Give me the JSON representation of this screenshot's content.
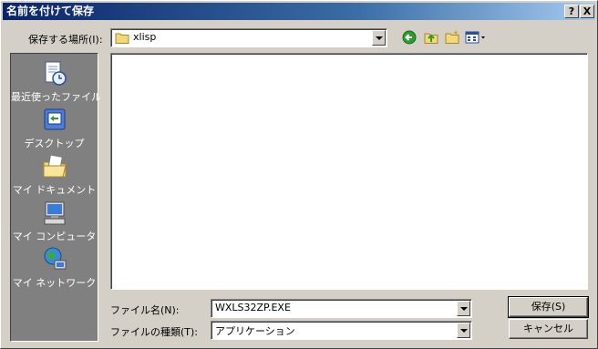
{
  "window": {
    "title": "名前を付けて保存",
    "help_glyph": "?",
    "close_glyph": "X"
  },
  "location": {
    "label": "保存する場所(I):",
    "folder": "xlisp"
  },
  "places": [
    {
      "label": "最近使ったファイル",
      "icon": "recent-documents-icon"
    },
    {
      "label": "デスクトップ",
      "icon": "desktop-icon"
    },
    {
      "label": "マイ ドキュメント",
      "icon": "my-documents-icon"
    },
    {
      "label": "マイ コンピュータ",
      "icon": "my-computer-icon"
    },
    {
      "label": "マイ ネットワーク",
      "icon": "my-network-icon"
    }
  ],
  "filename": {
    "label": "ファイル名(N):",
    "value": "WXLS32ZP.EXE"
  },
  "filetype": {
    "label": "ファイルの種類(T):",
    "value": "アプリケーション"
  },
  "buttons": {
    "save": "保存(S)",
    "cancel": "キャンセル"
  }
}
